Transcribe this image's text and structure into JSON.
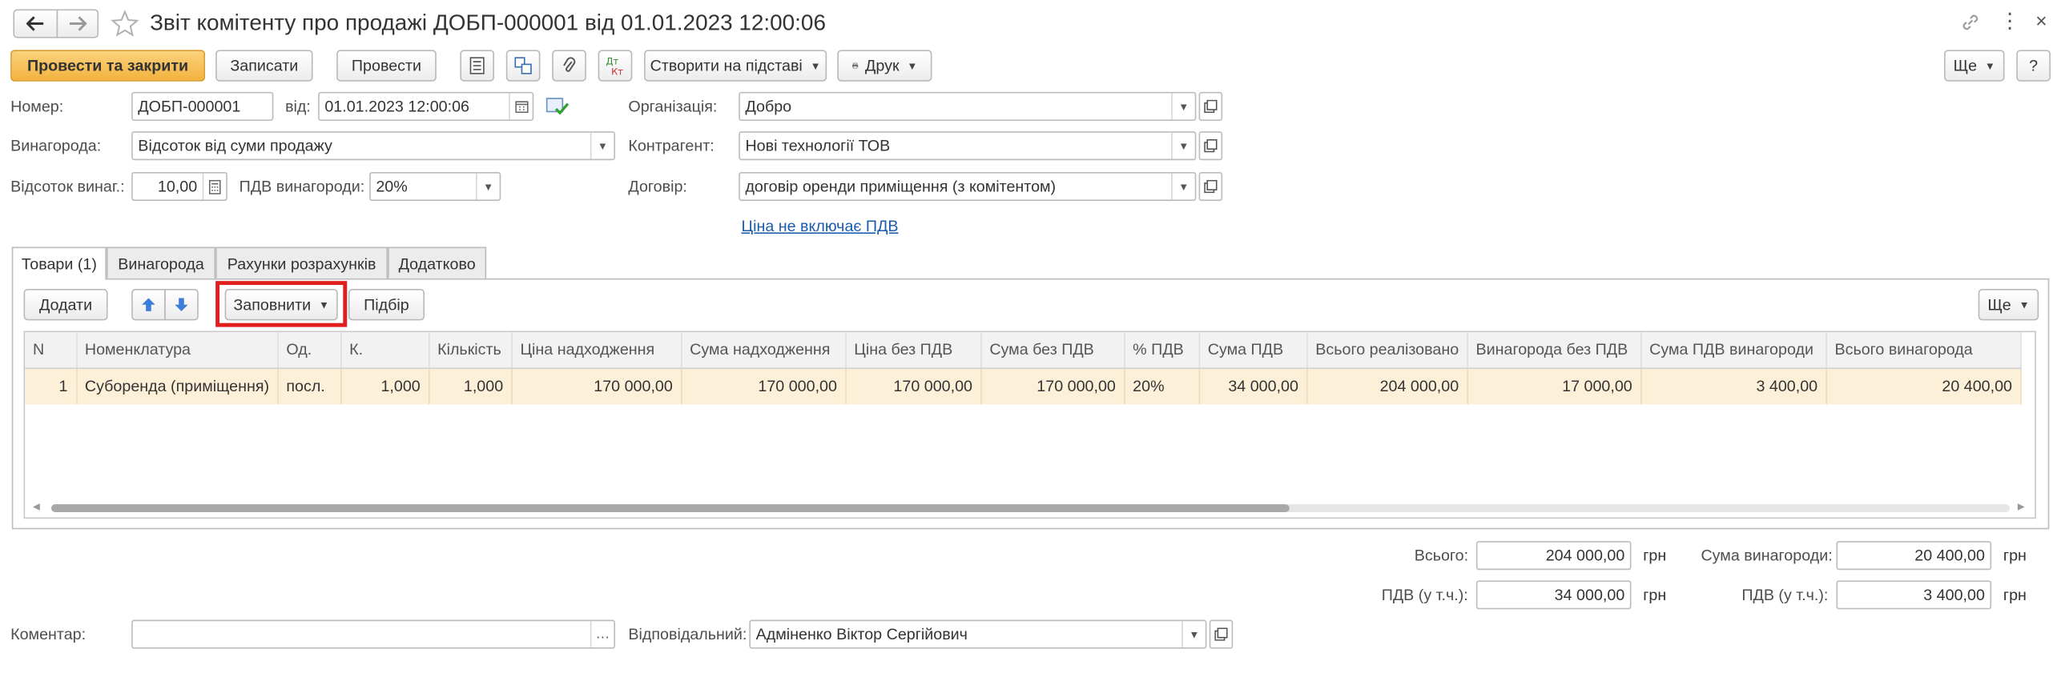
{
  "window": {
    "title": "Звіт комітенту про продажі ДОБП-000001 від 01.01.2023 12:00:06"
  },
  "toolbar": {
    "post_close": "Провести та закрити",
    "save": "Записати",
    "post": "Провести",
    "create_based": "Створити на підставі",
    "print": "Друк",
    "more": "Ще",
    "help": "?"
  },
  "header": {
    "number_label": "Номер:",
    "number_value": "ДОБП-000001",
    "date_label": "від:",
    "date_value": "01.01.2023 12:00:06",
    "org_label": "Організація:",
    "org_value": "Добро",
    "reward_label": "Винагорода:",
    "reward_value": "Відсоток від суми продажу",
    "counterparty_label": "Контрагент:",
    "counterparty_value": "Нові технології ТОВ",
    "percent_label": "Відсоток винаг.:",
    "percent_value": "10,00",
    "vat_reward_label": "ПДВ винагороди:",
    "vat_reward_value": "20%",
    "contract_label": "Договір:",
    "contract_value": "договір оренди приміщення (з комітентом)",
    "price_link": "Ціна не включає ПДВ"
  },
  "tabs": [
    {
      "label": "Товари (1)"
    },
    {
      "label": "Винагорода"
    },
    {
      "label": "Рахунки розрахунків"
    },
    {
      "label": "Додатково"
    }
  ],
  "table_toolbar": {
    "add": "Додати",
    "fill": "Заповнити",
    "pick": "Підбір",
    "more": "Ще"
  },
  "table": {
    "columns": [
      "N",
      "Номенклатура",
      "Од.",
      "К.",
      "Кількість",
      "Ціна надходження",
      "Сума надходження",
      "Ціна без ПДВ",
      "Сума без ПДВ",
      "% ПДВ",
      "Сума ПДВ",
      "Всього реалізовано",
      "Винагорода без ПДВ",
      "Сума ПДВ винагороди",
      "Всього винагорода"
    ],
    "rows": [
      [
        "1",
        "Суборенда (приміщення)",
        "посл.",
        "1,000",
        "1,000",
        "170 000,00",
        "170 000,00",
        "170 000,00",
        "170 000,00",
        "20%",
        "34 000,00",
        "204 000,00",
        "17 000,00",
        "3 400,00",
        "20 400,00"
      ]
    ]
  },
  "totals": {
    "total_label": "Всього:",
    "total_value": "204 000,00",
    "vat_label": "ПДВ (у т.ч.):",
    "vat_value": "34 000,00",
    "reward_sum_label": "Сума винагороди:",
    "reward_sum_value": "20 400,00",
    "reward_vat_label": "ПДВ (у т.ч.):",
    "reward_vat_value": "3 400,00",
    "currency": "грн"
  },
  "footer": {
    "comment_label": "Коментар:",
    "comment_value": "",
    "responsible_label": "Відповідальний:",
    "responsible_value": "Адміненко Віктор Сергійович"
  },
  "colors": {
    "primary": "#f3b23f",
    "highlight_border": "#e01e1e",
    "row_selected": "#fdf0d8",
    "link": "#1a5bb0"
  }
}
